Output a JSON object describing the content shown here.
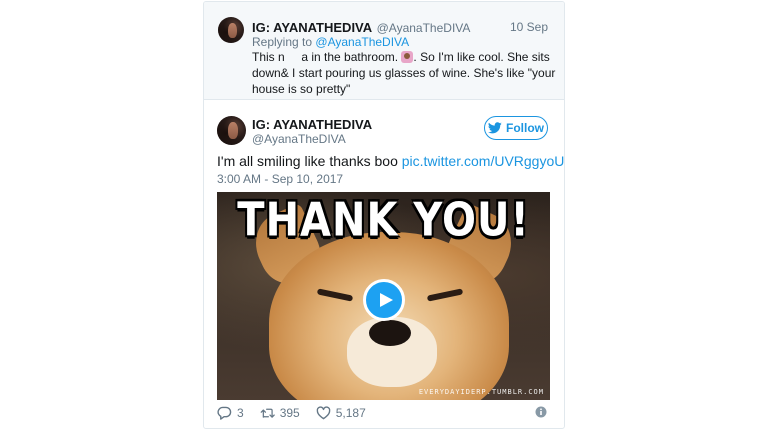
{
  "reply_tweet": {
    "display_name": "IG: AYANATHEDIVA",
    "handle": "@AyanaTheDIVA",
    "date": "10 Sep",
    "replying_prefix": "Replying to",
    "replying_to": "@AyanaTheDIVA",
    "text_part1": "This n     a in the bathroom. ",
    "text_part2": ". So I'm like cool. She sits down& I start pouring us glasses of wine. She's like \"your house is so pretty\""
  },
  "main_tweet": {
    "display_name": "IG: AYANATHEDIVA",
    "handle": "@AyanaTheDIVA",
    "follow_label": "Follow",
    "text": "I'm all smiling like thanks boo ",
    "link_text": "pic.twitter.com/UVRggyoUjf",
    "timestamp": "3:00 AM - Sep 10, 2017",
    "media": {
      "caption": "THANK YOU!",
      "watermark": "EVERYDAYIDERP.TUMBLR.COM"
    },
    "actions": {
      "replies": "3",
      "retweets": "395",
      "likes": "5,187"
    }
  },
  "colors": {
    "accent": "#1da1f2",
    "link": "#1b95e0",
    "muted": "#657786",
    "text": "#14171a",
    "border": "#e1e8ed"
  }
}
